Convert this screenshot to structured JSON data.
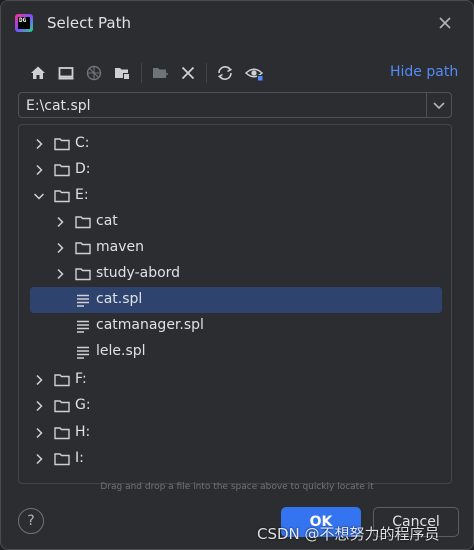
{
  "dialog": {
    "title": "Select Path",
    "app_icon_text": "DG"
  },
  "toolbar": {
    "home_tooltip": "home-icon",
    "hide_path_label": "Hide path"
  },
  "path": {
    "value": "E:\\cat.spl"
  },
  "tree": {
    "items": [
      {
        "label": "C:",
        "type": "folder",
        "expanded": false,
        "depth": 0
      },
      {
        "label": "D:",
        "type": "folder",
        "expanded": false,
        "depth": 0
      },
      {
        "label": "E:",
        "type": "folder",
        "expanded": true,
        "depth": 0
      },
      {
        "label": "cat",
        "type": "folder",
        "expanded": false,
        "depth": 1
      },
      {
        "label": "maven",
        "type": "folder",
        "expanded": false,
        "depth": 1
      },
      {
        "label": "study-abord",
        "type": "folder",
        "expanded": false,
        "depth": 1
      },
      {
        "label": "cat.spl",
        "type": "file",
        "selected": true,
        "depth": 1
      },
      {
        "label": "catmanager.spl",
        "type": "file",
        "depth": 1
      },
      {
        "label": "lele.spl",
        "type": "file",
        "depth": 1
      },
      {
        "label": "F:",
        "type": "folder",
        "expanded": false,
        "depth": 0
      },
      {
        "label": "G:",
        "type": "folder",
        "expanded": false,
        "depth": 0
      },
      {
        "label": "H:",
        "type": "folder",
        "expanded": false,
        "depth": 0
      },
      {
        "label": "I:",
        "type": "folder",
        "expanded": false,
        "depth": 0
      }
    ]
  },
  "hint": "Drag and drop a file into the space above to quickly locate it",
  "footer": {
    "help_label": "?",
    "ok_label": "OK",
    "cancel_label": "Cancel"
  },
  "watermark": "CSDN @不想努力的程序员",
  "colors": {
    "accent": "#3574f0",
    "selection": "#2e436e",
    "link": "#548af7",
    "background": "#2b2d30"
  }
}
